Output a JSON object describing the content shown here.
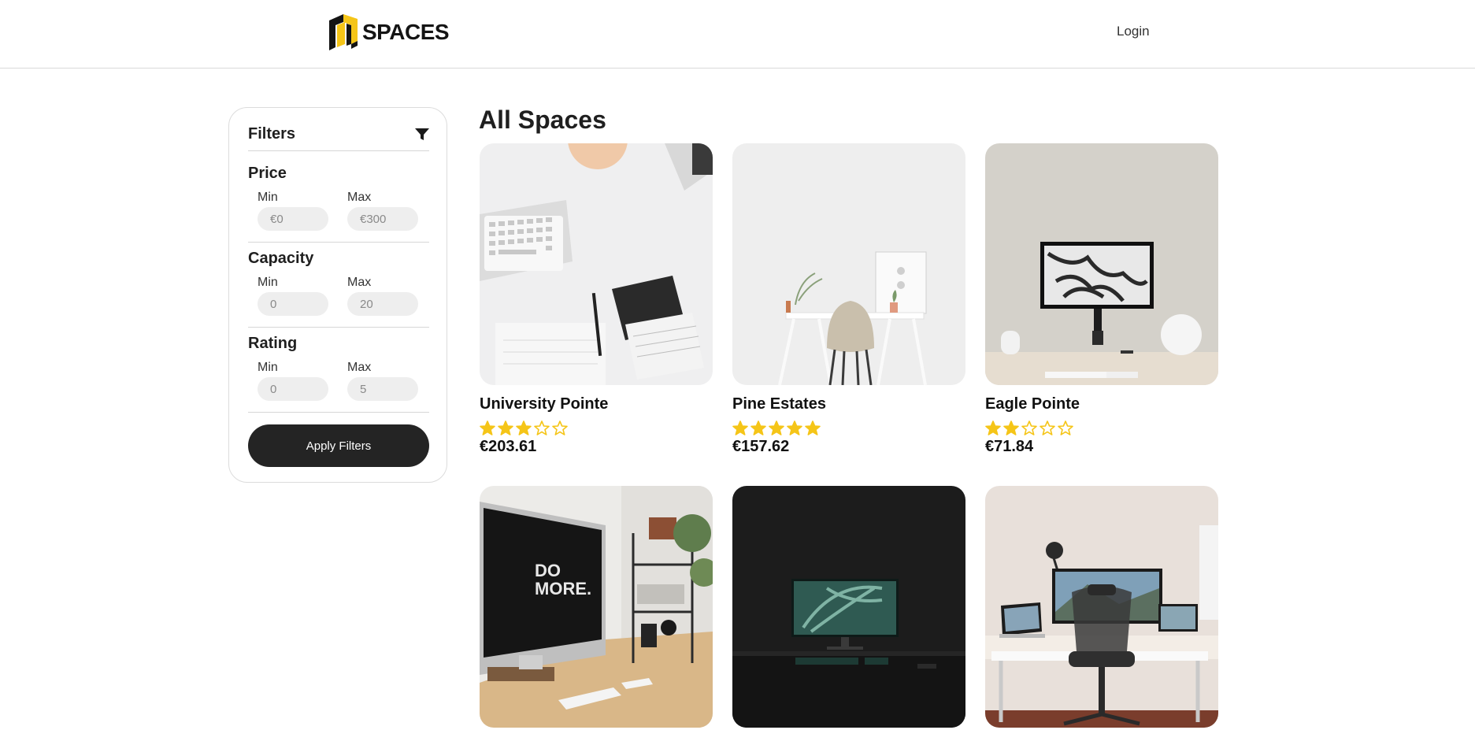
{
  "header": {
    "logo_text": "SPACES",
    "login_label": "Login"
  },
  "filters": {
    "title": "Filters",
    "apply_label": "Apply Filters",
    "groups": [
      {
        "title": "Price",
        "min_label": "Min",
        "max_label": "Max",
        "min_placeholder": "€0",
        "max_placeholder": "€300"
      },
      {
        "title": "Capacity",
        "min_label": "Min",
        "max_label": "Max",
        "min_placeholder": "0",
        "max_placeholder": "20"
      },
      {
        "title": "Rating",
        "min_label": "Min",
        "max_label": "Max",
        "min_placeholder": "0",
        "max_placeholder": "5"
      }
    ]
  },
  "main": {
    "title": "All Spaces",
    "spaces": [
      {
        "name": "University Pointe",
        "rating": 3,
        "price": "€203.61"
      },
      {
        "name": "Pine Estates",
        "rating": 5,
        "price": "€157.62"
      },
      {
        "name": "Eagle Pointe",
        "rating": 2,
        "price": "€71.84"
      },
      {
        "name": "",
        "rating": 0,
        "price": ""
      },
      {
        "name": "",
        "rating": 0,
        "price": ""
      },
      {
        "name": "",
        "rating": 0,
        "price": ""
      }
    ]
  },
  "colors": {
    "star": "#f5c518",
    "logo_yellow": "#f5c518",
    "button": "#242424"
  }
}
